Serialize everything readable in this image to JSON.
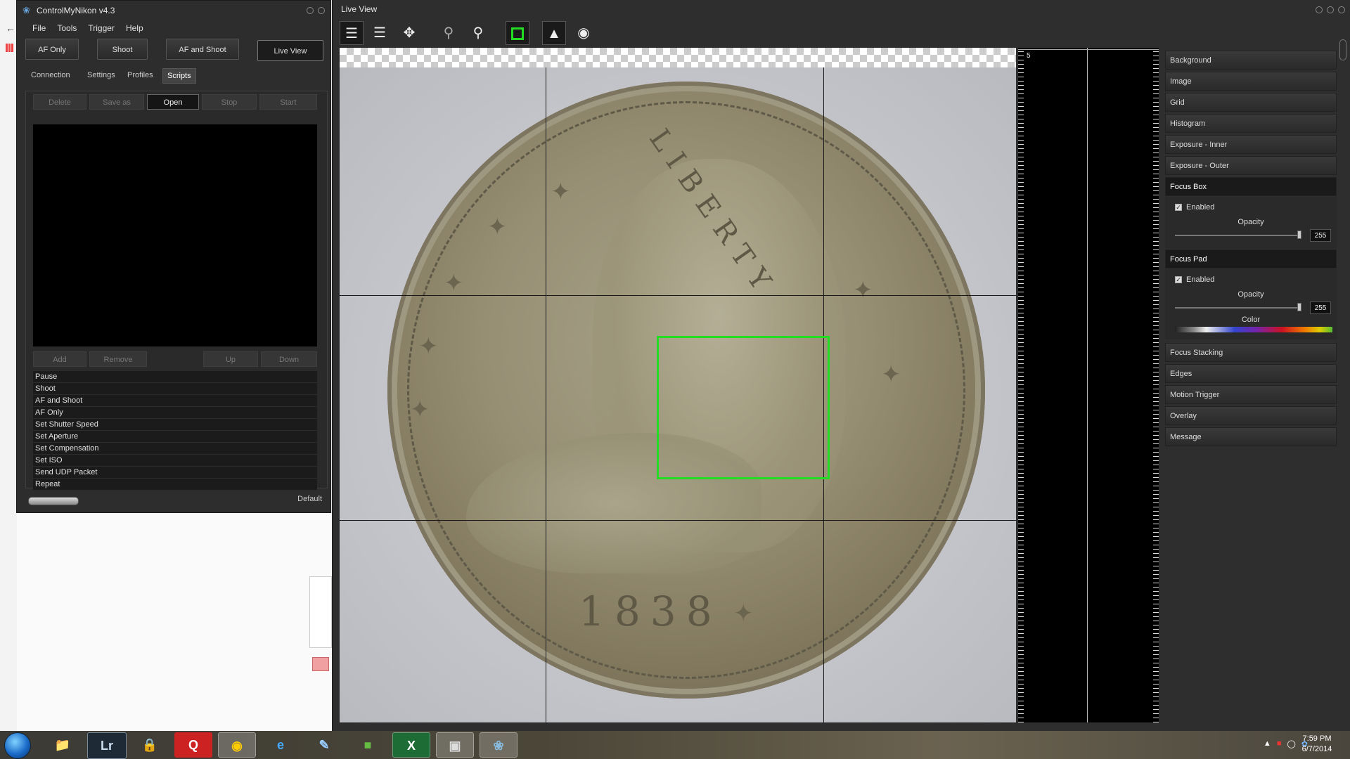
{
  "cmn": {
    "title": "ControlMyNikon v4.3",
    "menu": [
      "File",
      "Tools",
      "Trigger",
      "Help"
    ],
    "main_buttons": [
      "AF Only",
      "Shoot",
      "AF and Shoot",
      "Live View"
    ],
    "tabs": [
      "Connection",
      "Settings",
      "Profiles",
      "Scripts"
    ],
    "active_tab": "Scripts",
    "script_buttons": [
      "Delete",
      "Save as",
      "Open",
      "Stop",
      "Start"
    ],
    "list_buttons": [
      "Add",
      "Remove",
      "Up",
      "Down"
    ],
    "commands": [
      "Pause",
      "Shoot",
      "AF and Shoot",
      "AF Only",
      "Set Shutter Speed",
      "Set Aperture",
      "Set Compensation",
      "Set ISO",
      "Send UDP Packet",
      "Repeat"
    ],
    "status_profile": "Default"
  },
  "liveview": {
    "title": "Live View",
    "toolbar_icons": [
      "vertical-bars-icon",
      "horizontal-lines-icon",
      "move-icon",
      "zoom-out-icon",
      "zoom-in-icon",
      "focus-box-icon",
      "snapshot-icon",
      "record-icon"
    ],
    "ruler_number": "5",
    "coin_date": "1838",
    "coin_legend": "LIBERTY",
    "focus_box_color": "#22dd22"
  },
  "options": {
    "sections": [
      "Background",
      "Image",
      "Grid",
      "Histogram",
      "Exposure - Inner",
      "Exposure - Outer",
      "Focus Box",
      "Focus Pad",
      "Focus Stacking",
      "Edges",
      "Motion Trigger",
      "Overlay",
      "Message"
    ],
    "focus_box": {
      "enabled_label": "Enabled",
      "enabled": true,
      "opacity_label": "Opacity",
      "opacity_value": "255"
    },
    "focus_pad": {
      "enabled_label": "Enabled",
      "enabled": true,
      "opacity_label": "Opacity",
      "opacity_value": "255",
      "color_label": "Color"
    }
  },
  "taskbar": {
    "apps": [
      "explorer",
      "Lr",
      "lock",
      "Q",
      "chrome",
      "e",
      "notepad",
      "minecraft",
      "X",
      "camera",
      "controlmynikon"
    ],
    "time": "7:59 PM",
    "date": "6/7/2014"
  }
}
